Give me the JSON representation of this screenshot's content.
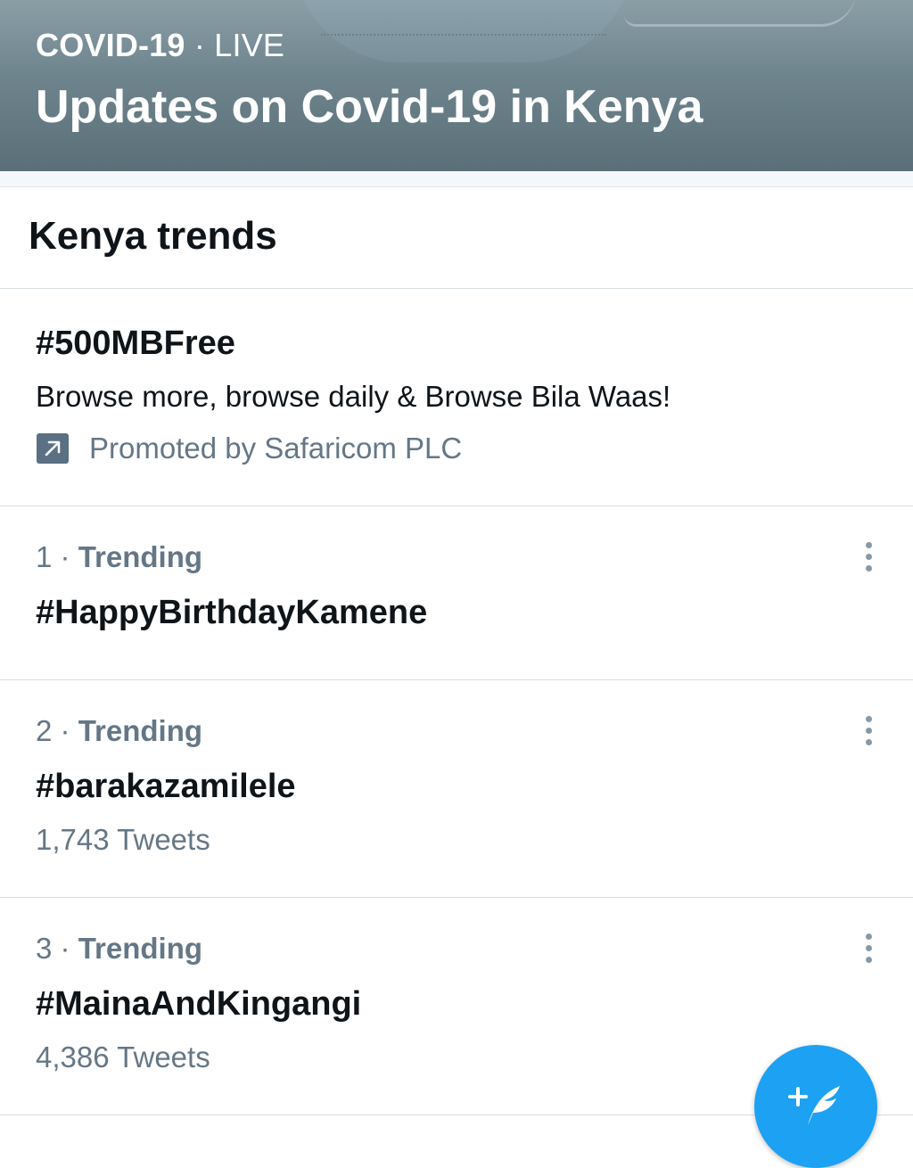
{
  "live_event": {
    "category": "COVID-19",
    "separator": "·",
    "status": "LIVE",
    "title": "Updates on Covid-19 in Kenya"
  },
  "trends_section": {
    "title": "Kenya trends"
  },
  "promoted_trend": {
    "hashtag": "#500MBFree",
    "description": "Browse more, browse daily & Browse Bila Waas!",
    "promoted_by": "Promoted by Safaricom PLC",
    "icon": "promoted-arrow-icon"
  },
  "trends": [
    {
      "rank": "1",
      "separator": "·",
      "label": "Trending",
      "name": "#HappyBirthdayKamene",
      "count": ""
    },
    {
      "rank": "2",
      "separator": "·",
      "label": "Trending",
      "name": "#barakazamilele",
      "count": "1,743 Tweets"
    },
    {
      "rank": "3",
      "separator": "·",
      "label": "Trending",
      "name": "#MainaAndKingangi",
      "count": "4,386 Tweets"
    }
  ],
  "compose_button": {
    "icon": "compose-tweet-icon"
  },
  "colors": {
    "accent": "#1da1f2",
    "secondary_text": "#657786",
    "primary_text": "#0f1419",
    "divider": "#d6dde2"
  }
}
